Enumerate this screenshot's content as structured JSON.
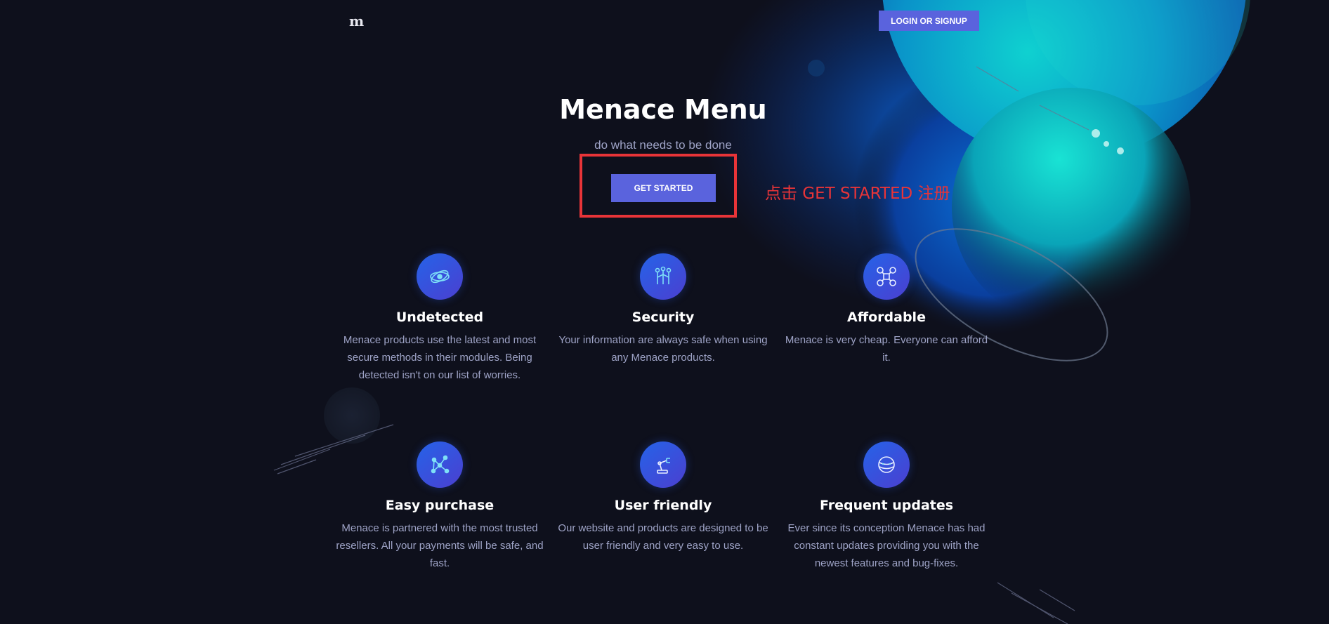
{
  "header": {
    "logo_text": "m",
    "login_label": "LOGIN OR SIGNUP"
  },
  "hero": {
    "title": "Menace Menu",
    "subtitle": "do what needs to be done",
    "cta_label": "GET STARTED",
    "annotation": "点击 GET STARTED 注册"
  },
  "features": [
    {
      "icon": "atom-icon",
      "title": "Undetected",
      "text": "Menace products use the latest and most secure methods in their modules. Being detected isn't on our list of worries."
    },
    {
      "icon": "circuit-icon",
      "title": "Security",
      "text": "Your information are always safe when using any Menace products."
    },
    {
      "icon": "drone-icon",
      "title": "Affordable",
      "text": "Menace is very cheap. Everyone can afford it."
    },
    {
      "icon": "network-icon",
      "title": "Easy purchase",
      "text": "Menace is partnered with the most trusted resellers. All your payments will be safe, and fast."
    },
    {
      "icon": "robot-arm-icon",
      "title": "User friendly",
      "text": "Our website and products are designed to be user friendly and very easy to use."
    },
    {
      "icon": "planet-icon",
      "title": "Frequent updates",
      "text": "Ever since its conception Menace has had constant updates providing you with the newest features and bug-fixes."
    }
  ],
  "colors": {
    "background": "#0e101c",
    "accent": "#5a63dd",
    "annotation": "#e83438",
    "muted_text": "#9ea3c6"
  }
}
